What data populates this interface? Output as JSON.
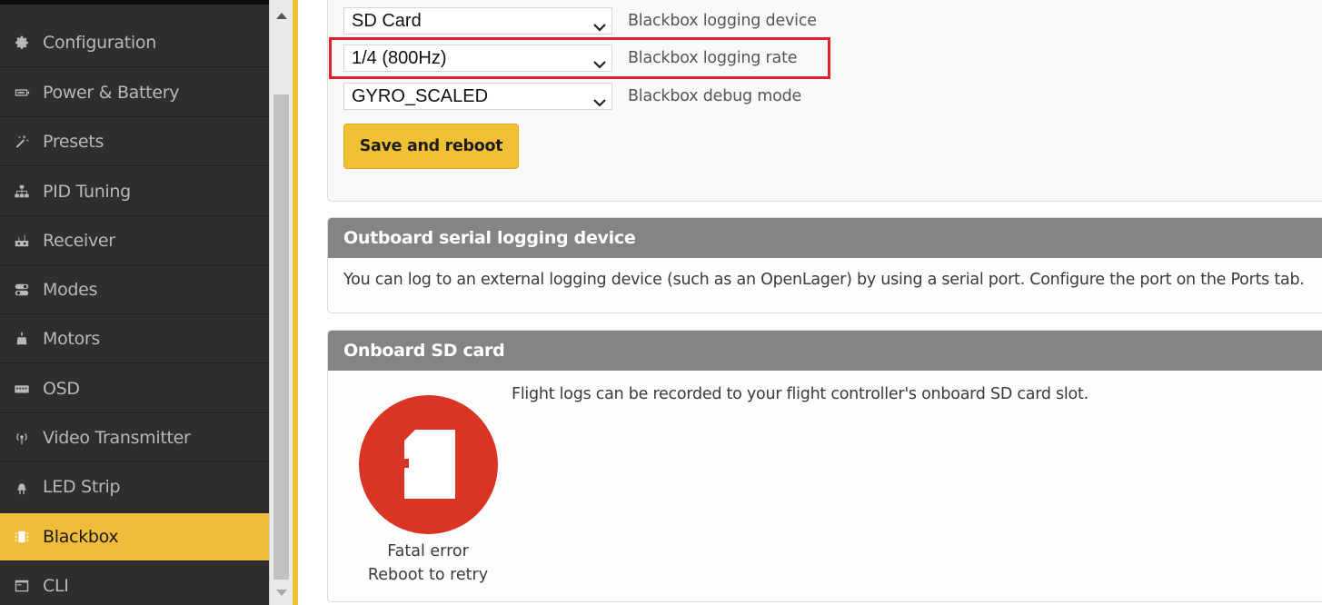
{
  "sidebar": {
    "items": [
      {
        "label": "Configuration",
        "icon": "gear-icon",
        "active": false
      },
      {
        "label": "Power & Battery",
        "icon": "battery-icon",
        "active": false
      },
      {
        "label": "Presets",
        "icon": "magic-wand-icon",
        "active": false
      },
      {
        "label": "PID Tuning",
        "icon": "sitemap-icon",
        "active": false
      },
      {
        "label": "Receiver",
        "icon": "receiver-icon",
        "active": false
      },
      {
        "label": "Modes",
        "icon": "toggle-icon",
        "active": false
      },
      {
        "label": "Motors",
        "icon": "motor-icon",
        "active": false
      },
      {
        "label": "OSD",
        "icon": "osd-icon",
        "active": false
      },
      {
        "label": "Video Transmitter",
        "icon": "broadcast-icon",
        "active": false
      },
      {
        "label": "LED Strip",
        "icon": "led-icon",
        "active": false
      },
      {
        "label": "Blackbox",
        "icon": "blackbox-icon",
        "active": true
      },
      {
        "label": "CLI",
        "icon": "terminal-icon",
        "active": false
      }
    ],
    "active_color": "#f0bd3a"
  },
  "settings": {
    "logging_device": {
      "value": "SD Card",
      "label": "Blackbox logging device"
    },
    "logging_rate": {
      "value": "1/4 (800Hz)",
      "label": "Blackbox logging rate"
    },
    "debug_mode": {
      "value": "GYRO_SCALED",
      "label": "Blackbox debug mode"
    },
    "save_button": "Save and reboot"
  },
  "outboard": {
    "title": "Outboard serial logging device",
    "text": "You can log to an external logging device (such as an OpenLager) by using a serial port. Configure the port on the Ports tab."
  },
  "onboard": {
    "title": "Onboard SD card",
    "text": "Flight logs can be recorded to your flight controller's onboard SD card slot.",
    "status_line1": "Fatal error",
    "status_line2": "Reboot to retry",
    "status_color": "#d93424"
  },
  "colors": {
    "accent": "#f2c033",
    "highlight": "#e0222a",
    "panel_header": "#828584"
  }
}
